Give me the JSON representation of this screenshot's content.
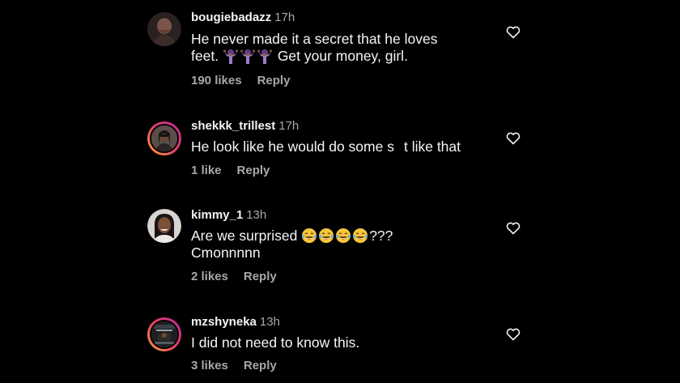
{
  "comments": [
    {
      "username": "bougiebadazz",
      "time": "17h",
      "text_line1": "He never made it a secret that he loves",
      "text_line2_prefix": "feet.",
      "text_line2_suffix": "Get your money, girl.",
      "emojis": [
        "person-shrugging-emoji",
        "person-shrugging-emoji",
        "person-shrugging-emoji"
      ],
      "likes": "190 likes",
      "reply": "Reply"
    },
    {
      "username": "shekkk_trillest",
      "time": "17h",
      "text_part1": "He look like he would do some s",
      "text_part2": "t like that",
      "likes": "1 like",
      "reply": "Reply"
    },
    {
      "username": "kimmy_1",
      "time": "13h",
      "text_line1_prefix": "Are we surprised",
      "text_line1_suffix": "???",
      "emojis": [
        "tears-of-joy-emoji",
        "tears-of-joy-emoji",
        "tears-of-joy-emoji",
        "tears-of-joy-emoji"
      ],
      "text_line2": "Cmonnnnn",
      "likes": "2 likes",
      "reply": "Reply"
    },
    {
      "username": "mzshyneka",
      "time": "13h",
      "text": "I did not need to know this.",
      "likes": "3 likes",
      "reply": "Reply"
    }
  ],
  "colors": {
    "background": "#000000",
    "text": "#f5f5f5",
    "secondary": "#a8a8a8",
    "story_ring_start": "#f9a23a",
    "story_ring_end": "#b72fa0"
  }
}
